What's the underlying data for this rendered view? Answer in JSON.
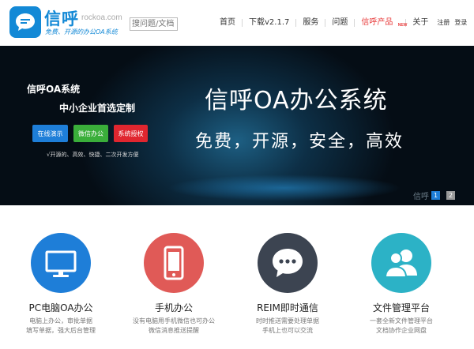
{
  "header": {
    "brand_name": "信呼",
    "brand_domain": "rockoa.com",
    "brand_slogan": "免费、开源的办公OA系统",
    "search_placeholder": "搜问题/文档",
    "nav": [
      {
        "label": "首页"
      },
      {
        "label": "下载v2.1.7"
      },
      {
        "label": "服务"
      },
      {
        "label": "问题"
      },
      {
        "label": "信呼产品",
        "badge": "NEW"
      },
      {
        "label": "关于"
      }
    ],
    "register_label": "注册",
    "login_label": "登录"
  },
  "banner": {
    "left_title": "信呼OA系统",
    "left_subtitle": "中小企业首选定制",
    "buttons": [
      {
        "label": "在线演示",
        "color": "#1e7ed8"
      },
      {
        "label": "微信办公",
        "color": "#3aae3a"
      },
      {
        "label": "系统授权",
        "color": "#e0262f"
      }
    ],
    "note": "√开源的、高效、快捷、二次开发方便",
    "main_title": "信呼OA办公系统",
    "slogan": "免费，开源，安全，高效",
    "slide_label": "信呼",
    "slides": [
      "1",
      "2"
    ],
    "active_slide": "1"
  },
  "features": [
    {
      "icon": "monitor-icon",
      "color": "#1e7ed8",
      "title": "PC电脑OA办公",
      "desc1": "电脑上办公，审批单据",
      "desc2": "填写单据，强大后台管理"
    },
    {
      "icon": "smartphone-icon",
      "color": "#e05a57",
      "title": "手机办公",
      "desc1": "没有电脑用手机微信也可办公",
      "desc2": "微信消息推送提醒"
    },
    {
      "icon": "chat-bubble-icon",
      "color": "#3c4451",
      "title": "REIM即时通信",
      "desc1": "时时推送需要处理单据",
      "desc2": "手机上也可以交流"
    },
    {
      "icon": "users-icon",
      "color": "#2cb2c6",
      "title": "文件管理平台",
      "desc1": "一套全新文件管理平台",
      "desc2": "文档协作企业网盘"
    }
  ]
}
